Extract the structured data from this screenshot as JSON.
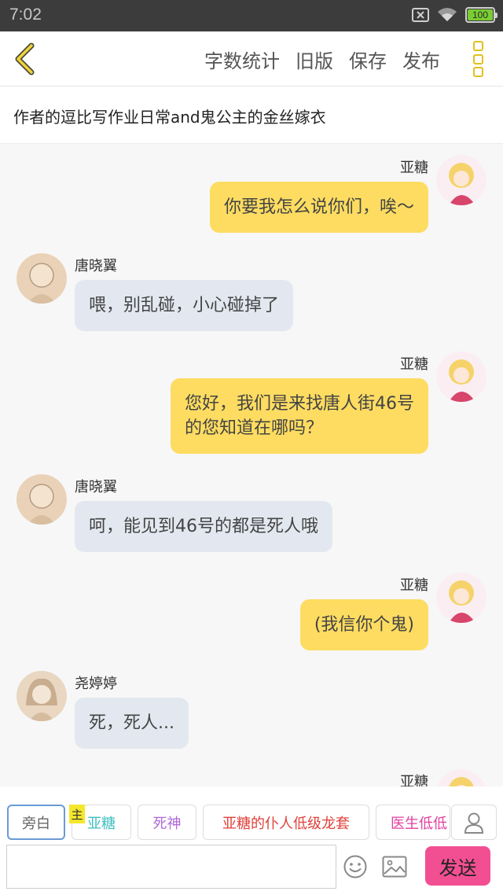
{
  "status_bar": {
    "time": "7:02",
    "battery": "100"
  },
  "toolbar": {
    "actions": [
      "字数统计",
      "旧版",
      "保存",
      "发布"
    ]
  },
  "title": "作者的逗比写作业日常and鬼公主的金丝嫁衣",
  "messages": [
    {
      "side": "right",
      "name": "亚糖",
      "lines": [
        "你要我怎么说你们，唉～"
      ]
    },
    {
      "side": "left",
      "name": "唐晓翼",
      "lines": [
        "喂，别乱碰，小心碰掉了"
      ]
    },
    {
      "side": "right",
      "name": "亚糖",
      "lines": [
        "您好，我们是来找唐人街46号",
        "的您知道在哪吗？"
      ]
    },
    {
      "side": "left",
      "name": "唐晓翼",
      "lines": [
        "呵，能见到46号的都是死人哦"
      ]
    },
    {
      "side": "right",
      "name": "亚糖",
      "lines": [
        "(我信你个鬼)"
      ]
    },
    {
      "side": "left",
      "name": "尧婷婷",
      "lines": [
        "死，死人..."
      ]
    },
    {
      "side": "right",
      "name": "亚糖",
      "lines": []
    }
  ],
  "roles": {
    "host_badge": "主",
    "items": [
      {
        "label": "旁白",
        "color": "#666666"
      },
      {
        "label": "亚糖",
        "color": "#3fbfc0"
      },
      {
        "label": "死神",
        "color": "#b06ad8"
      },
      {
        "label": "亚糖的仆人低级龙套",
        "color": "#e0413a"
      },
      {
        "label": "医生低低",
        "color": "#e23fa0"
      }
    ]
  },
  "input": {
    "value": "",
    "placeholder": ""
  },
  "send_label": "发送",
  "colors": {
    "accent_yellow": "#fddc61",
    "left_bubble": "#e3e8f0",
    "send_pink": "#f24f93",
    "icon_yellow": "#e2c020"
  }
}
